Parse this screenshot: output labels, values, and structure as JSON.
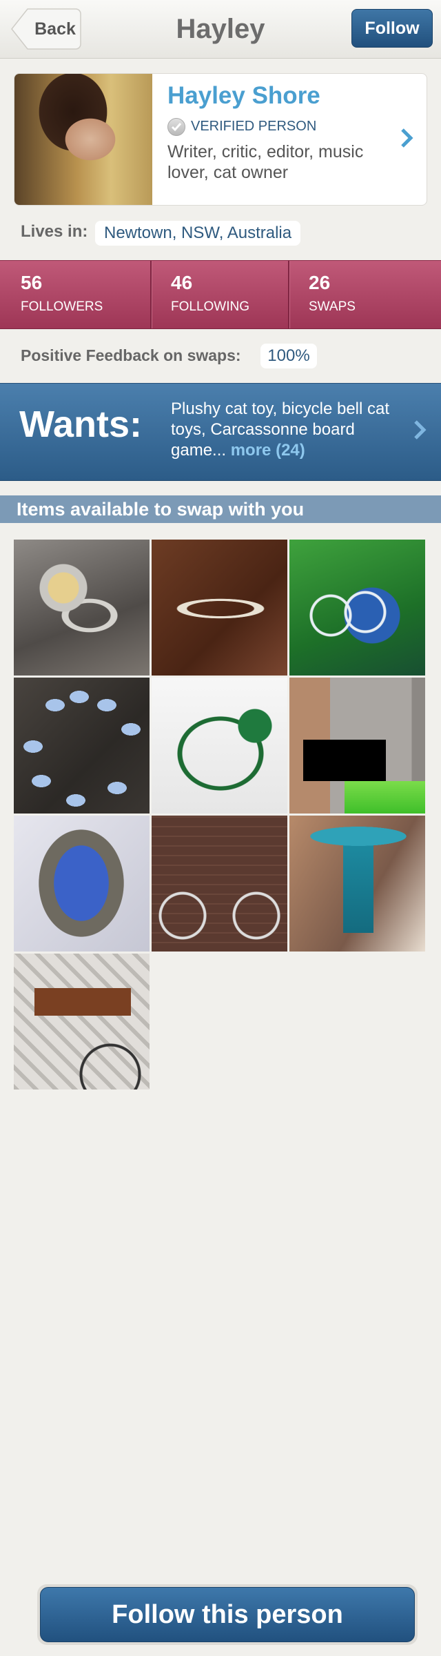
{
  "nav": {
    "back_label": "Back",
    "title": "Hayley",
    "follow_label": "Follow"
  },
  "profile": {
    "name": "Hayley Shore",
    "verified_label": "VERIFIED PERSON",
    "bio": "Writer, critic, editor, music lover, cat owner",
    "lives_in_label": "Lives in:",
    "location": "Newtown, NSW, Australia"
  },
  "stats": [
    {
      "value": "56",
      "label": "FOLLOWERS"
    },
    {
      "value": "46",
      "label": "FOLLOWING"
    },
    {
      "value": "26",
      "label": "SWAPS"
    }
  ],
  "feedback": {
    "label": "Positive Feedback on swaps:",
    "value": "100%"
  },
  "wants": {
    "title": "Wants:",
    "text": "Plushy cat toy, bicycle bell cat toys, Carcassonne board game...",
    "more": "more (24)"
  },
  "items_section": {
    "title": "Items available to swap with you",
    "items": [
      {
        "icon": "ring-photo"
      },
      {
        "icon": "infinity-ring-photo"
      },
      {
        "icon": "earrings-photo"
      },
      {
        "icon": "bracelet-photo"
      },
      {
        "icon": "necklace-photo"
      },
      {
        "icon": "clutch-bag-photo"
      },
      {
        "icon": "blue-ring-photo"
      },
      {
        "icon": "bicycle-photo"
      },
      {
        "icon": "mosaic-birdbath-photo"
      },
      {
        "icon": "bike-basket-photo"
      }
    ]
  },
  "bottom": {
    "follow_label": "Follow this person"
  },
  "colors": {
    "accent_blue": "#2c5c88",
    "name_blue": "#4a9fd0",
    "stats_red": "#ae4464",
    "section_header": "#7c9ab6"
  }
}
